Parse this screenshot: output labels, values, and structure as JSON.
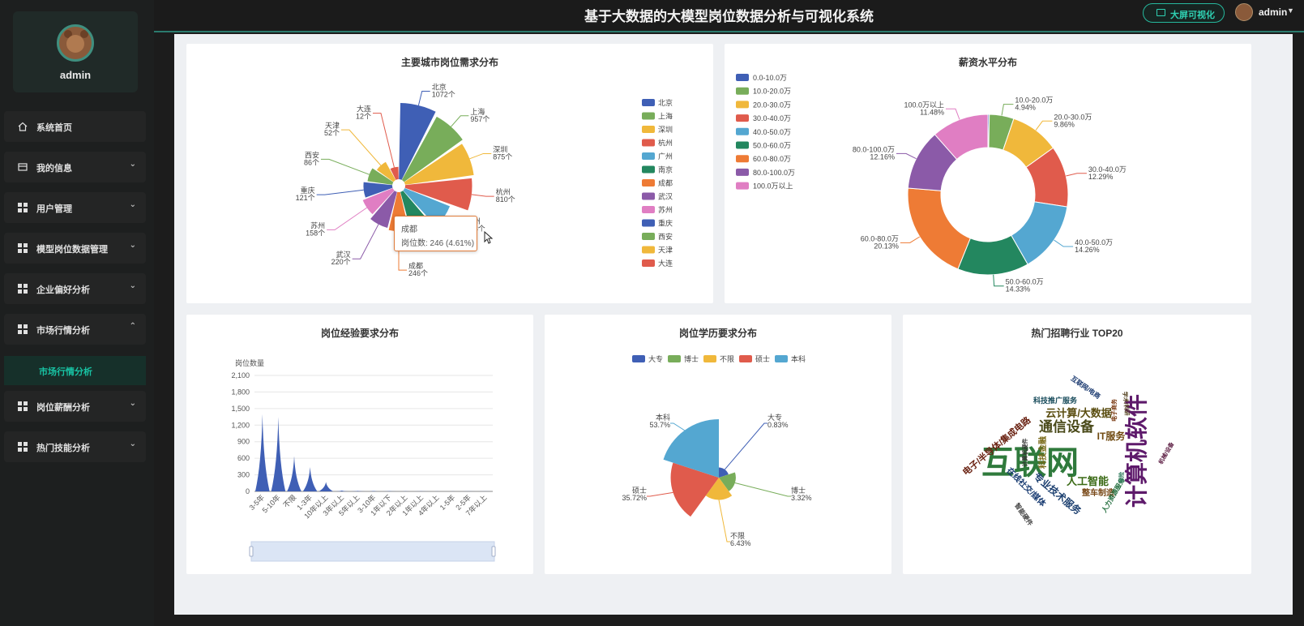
{
  "app": {
    "title": "基于大数据的大模型岗位数据分析与可视化系统"
  },
  "header": {
    "bigscreen_label": "大屏可视化",
    "user": "admin"
  },
  "profile": {
    "name": "admin"
  },
  "menu": {
    "items": [
      {
        "label": "系统首页",
        "icon": "home-icon"
      },
      {
        "label": "我的信息",
        "icon": "id-card-icon",
        "arrow": "⌄"
      },
      {
        "label": "用户管理",
        "icon": "grid-icon",
        "arrow": "⌄"
      },
      {
        "label": "模型岗位数据管理",
        "icon": "grid-icon",
        "arrow": "⌄"
      },
      {
        "label": "企业偏好分析",
        "icon": "grid-icon",
        "arrow": "⌄"
      },
      {
        "label": "市场行情分析",
        "icon": "grid-icon",
        "arrow": "⌃"
      },
      {
        "label": "岗位薪酬分析",
        "icon": "grid-icon",
        "arrow": "⌄"
      },
      {
        "label": "热门技能分析",
        "icon": "grid-icon",
        "arrow": "⌄"
      }
    ],
    "active_sub": "市场行情分析"
  },
  "cards": {
    "city": "主要城市岗位需求分布",
    "salary": "薪资水平分布",
    "experience": "岗位经验要求分布",
    "education": "岗位学历要求分布",
    "industry": "热门招聘行业 TOP20"
  },
  "tooltip": {
    "title": "成都",
    "value": "岗位数: 246 (4.61%)"
  },
  "colors": {
    "blue": "#3f5fb5",
    "green": "#78ad5a",
    "yellow": "#f0b83b",
    "red": "#e05b4c",
    "lightblue": "#54a7d1",
    "darkgreen": "#23875f",
    "orange": "#ee7b35",
    "purple": "#8b5aa8",
    "pink": "#e07ec3"
  },
  "chart_data": [
    {
      "type": "pie",
      "title": "主要城市岗位需求分布",
      "rose": true,
      "legend_position": "right",
      "categories": [
        "北京",
        "上海",
        "深圳",
        "杭州",
        "广州",
        "南京",
        "成都",
        "武汉",
        "苏州",
        "重庆",
        "西安",
        "天津",
        "大连"
      ],
      "values": [
        1072,
        957,
        875,
        810,
        403,
        302,
        246,
        220,
        158,
        121,
        86,
        52,
        12
      ],
      "value_suffix": "个",
      "visible_labels": [
        "北京",
        "上海",
        "深圳",
        "杭州",
        "广州",
        "南京",
        "成都",
        "武汉",
        "苏州",
        "重庆",
        "西安",
        "天津",
        "大连"
      ]
    },
    {
      "type": "pie",
      "title": "薪资水平分布",
      "donut": true,
      "legend_position": "top-left",
      "categories": [
        "0.0-10.0万",
        "10.0-20.0万",
        "20.0-30.0万",
        "30.0-40.0万",
        "40.0-50.0万",
        "50.0-60.0万",
        "60.0-80.0万",
        "80.0-100.0万",
        "100.0万以上"
      ],
      "values": [
        0.27,
        4.94,
        9.86,
        12.29,
        14.26,
        14.33,
        20.13,
        12.16,
        11.48
      ],
      "labels": [
        "",
        "4.94%",
        "9.86%",
        "12.29%",
        "14.26%",
        "14.33%",
        "20.13%",
        "12.16%",
        "11.48%"
      ]
    },
    {
      "type": "area",
      "title": "岗位经验要求分布",
      "ylabel": "岗位数量",
      "ylim": [
        0,
        2100
      ],
      "yticks": [
        "0",
        "300",
        "600",
        "900",
        "1,200",
        "1,500",
        "1,800",
        "2,100"
      ],
      "categories": [
        "3-5年",
        "5-10年",
        "不限",
        "1-3年",
        "10年以上",
        "3年以上",
        "5年以上",
        "3-10年",
        "1年以下",
        "2年以上",
        "1年以上",
        "4年以上",
        "1-5年",
        "2-5年",
        "7年以上"
      ],
      "values": [
        1400,
        1350,
        640,
        440,
        170,
        15,
        10,
        8,
        5,
        4,
        3,
        2,
        2,
        1,
        1
      ],
      "has_zoom_slider": true
    },
    {
      "type": "pie",
      "title": "岗位学历要求分布",
      "rose": true,
      "legend_position": "top",
      "categories": [
        "大专",
        "博士",
        "不限",
        "硕士",
        "本科"
      ],
      "values": [
        0.83,
        3.32,
        6.43,
        35.72,
        53.7
      ],
      "labels": [
        "0.83%",
        "3.32%",
        "6.43%",
        "35.72%",
        "53.7%"
      ]
    }
  ],
  "wordcloud": [
    {
      "text": "互联网",
      "color": "#2f7a3c",
      "size": 40
    },
    {
      "text": "计算机软件",
      "color": "#5e1a6b",
      "size": 28,
      "vertical": true
    },
    {
      "text": "通信设备",
      "color": "#4a4a1a",
      "size": 17
    },
    {
      "text": "云计算/大数据",
      "color": "#5a4d10",
      "size": 13
    },
    {
      "text": "人工智能",
      "color": "#3a6a15",
      "size": 13
    },
    {
      "text": "专业技术服务",
      "color": "#1d4070",
      "size": 12
    },
    {
      "text": "IT服务",
      "color": "#704a10",
      "size": 12
    },
    {
      "text": "电子/半导体/集成电路",
      "color": "#6a2212",
      "size": 11
    },
    {
      "text": "在线社交/媒体",
      "color": "#173a70",
      "size": 10
    },
    {
      "text": "科技推广服务",
      "color": "#164a5a",
      "size": 9
    },
    {
      "text": "整车制造",
      "color": "#7a4a1a",
      "size": 10
    },
    {
      "text": "科技金融",
      "color": "#7a6a18",
      "size": 10
    },
    {
      "text": "人力资源服务",
      "color": "#1e6b3a",
      "size": 8
    },
    {
      "text": "互联网/电商",
      "color": "#1b3a70",
      "size": 8
    },
    {
      "text": "智能硬件",
      "color": "#444444",
      "size": 8
    },
    {
      "text": "计算机硬件",
      "color": "#333333",
      "size": 7
    },
    {
      "text": "电子商务",
      "color": "#7a3a12",
      "size": 7
    },
    {
      "text": "保险",
      "color": "#2c7a5a",
      "size": 7
    },
    {
      "text": "机械/设备",
      "color": "#5a1a40",
      "size": 7
    },
    {
      "text": "学术/科研",
      "color": "#554422",
      "size": 7
    }
  ]
}
